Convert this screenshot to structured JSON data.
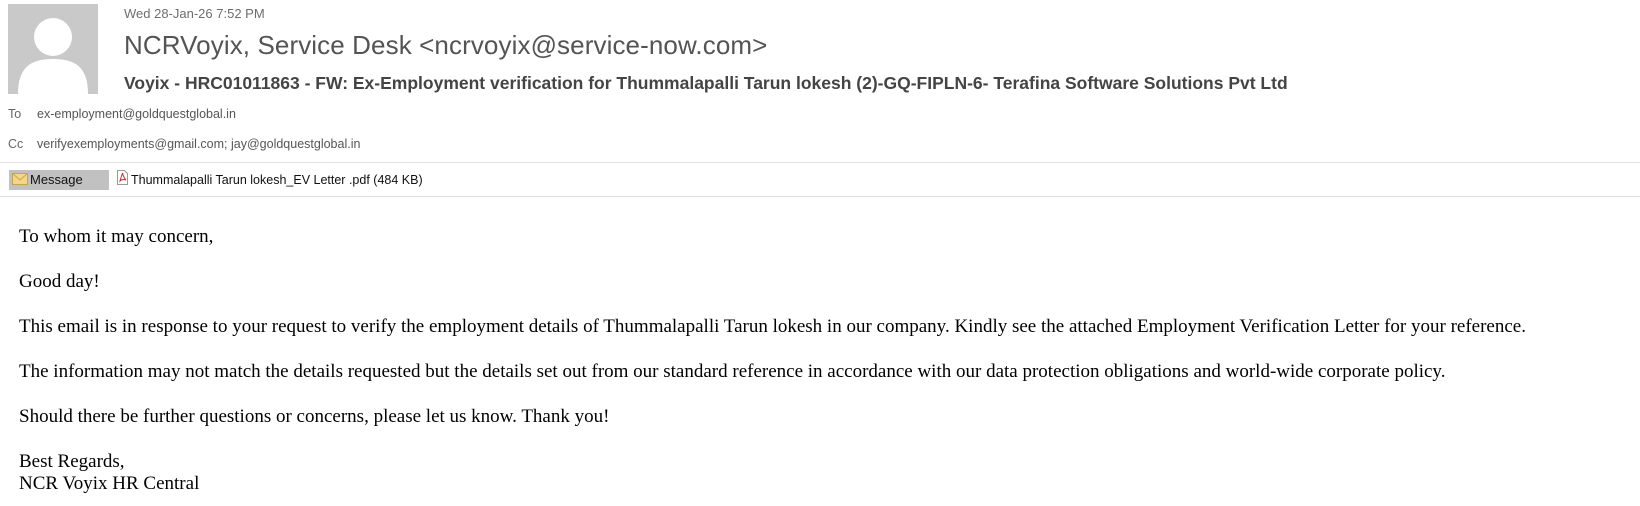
{
  "header": {
    "date": "Wed 28-Jan-26 7:52 PM",
    "from": "NCRVoyix, Service Desk <ncrvoyix@service-now.com>",
    "subject": "Voyix - HRC01011863 - FW: Ex-Employment verification for Thummalapalli Tarun lokesh (2)-GQ-FIPLN-6- Terafina Software Solutions Pvt Ltd",
    "to_label": "To",
    "to": "ex-employment@goldquestglobal.in",
    "cc_label": "Cc",
    "cc": "verifyexemployments@gmail.com; jay@goldquestglobal.in"
  },
  "attachments": {
    "message_tab": "Message",
    "file_name": "Thummalapalli Tarun lokesh_EV Letter .pdf",
    "file_size": "(484 KB)"
  },
  "body": {
    "greeting": "To whom it may concern,",
    "good_day": "Good day!",
    "para1": "This email is in response to your request to verify the employment details of Thummalapalli Tarun lokesh in our company. Kindly see the attached Employment Verification Letter for your reference.",
    "para2": "The information may not match the details requested but the details set out from our standard reference in accordance with our data protection obligations and world-wide corporate policy.",
    "para3": "Should there be further questions or concerns, please let us know. Thank you!",
    "closing": "Best Regards,",
    "signature": "NCR Voyix HR Central"
  },
  "icons": {
    "avatar": "person-placeholder-icon",
    "message": "envelope-icon",
    "attachment": "pdf-file-icon"
  },
  "colors": {
    "avatar_bg": "#c9c9c9",
    "tab_bg": "#c1c1c1",
    "pdf_red": "#d32f2f"
  }
}
